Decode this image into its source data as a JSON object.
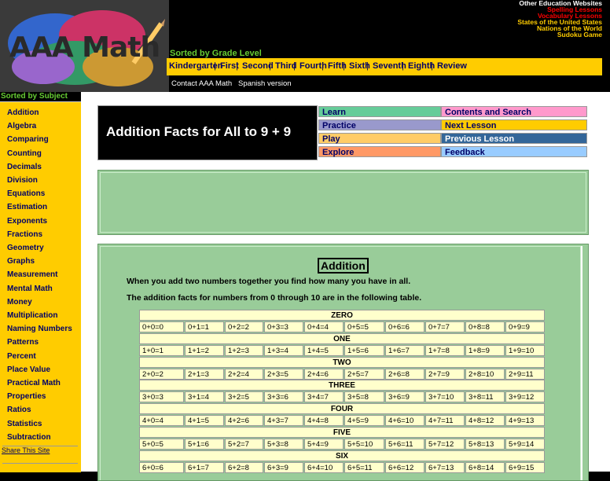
{
  "logo": {
    "text": "AAA Math"
  },
  "other_links": [
    {
      "label": "Other Education Websites",
      "color": "#ffffff"
    },
    {
      "label": "Spelling Lessons",
      "color": "#ff0000"
    },
    {
      "label": "Vocabulary Lessons",
      "color": "#ff0000"
    },
    {
      "label": "States of the United States",
      "color": "#ffcc00"
    },
    {
      "label": "Nations of the World",
      "color": "#ffcc00"
    },
    {
      "label": "Sudoku Game",
      "color": "#ffcc00"
    }
  ],
  "sorted_by_grade": "Sorted by Grade Level",
  "grades": [
    "Kindergarten",
    "First",
    "Second",
    "Third",
    "Fourth",
    "Fifth",
    "Sixth",
    "Seventh",
    "Eighth",
    "Review"
  ],
  "grade_separator": "|",
  "contact": "Contact AAA Math",
  "spanish": "Spanish version",
  "sorted_by_subject": "Sorted by Subject",
  "subjects": [
    "Addition",
    "Algebra",
    "Comparing",
    "Counting",
    "Decimals",
    "Division",
    "Equations",
    "Estimation",
    "Exponents",
    "Fractions",
    "Geometry",
    "Graphs",
    "Measurement",
    "Mental Math",
    "Money",
    "Multiplication",
    "Naming Numbers",
    "Patterns",
    "Percent",
    "Place Value",
    "Practical Math",
    "Properties",
    "Ratios",
    "Statistics",
    "Subtraction"
  ],
  "share": "Share This Site",
  "page_title": "Addition Facts for All to 9 + 9",
  "tabs": [
    {
      "label": "Learn",
      "bg": "#66cc99",
      "color": "#000066"
    },
    {
      "label": "Contents and Search",
      "bg": "#ff99cc",
      "color": "#000066"
    },
    {
      "label": "Practice",
      "bg": "#9999cc",
      "color": "#000066"
    },
    {
      "label": "Next Lesson",
      "bg": "#ffcc00",
      "color": "#000066"
    },
    {
      "label": "Play",
      "bg": "#ffcc66",
      "color": "#000066"
    },
    {
      "label": "Previous Lesson",
      "bg": "#336699",
      "color": "#ffffff"
    },
    {
      "label": "Explore",
      "bg": "#ff9966",
      "color": "#000066"
    },
    {
      "label": "Feedback",
      "bg": "#99ccff",
      "color": "#000066"
    }
  ],
  "section_title": "Addition",
  "paragraph1": "When you add two numbers together you find how many you have in all.",
  "paragraph2": "The addition facts for numbers from 0 through 10 are in the following table.",
  "fact_groups": [
    {
      "title": "ZERO",
      "facts": [
        "0+0=0",
        "0+1=1",
        "0+2=2",
        "0+3=3",
        "0+4=4",
        "0+5=5",
        "0+6=6",
        "0+7=7",
        "0+8=8",
        "0+9=9"
      ]
    },
    {
      "title": "ONE",
      "facts": [
        "1+0=1",
        "1+1=2",
        "1+2=3",
        "1+3=4",
        "1+4=5",
        "1+5=6",
        "1+6=7",
        "1+7=8",
        "1+8=9",
        "1+9=10"
      ]
    },
    {
      "title": "TWO",
      "facts": [
        "2+0=2",
        "2+1=3",
        "2+2=4",
        "2+3=5",
        "2+4=6",
        "2+5=7",
        "2+6=8",
        "2+7=9",
        "2+8=10",
        "2+9=11"
      ]
    },
    {
      "title": "THREE",
      "facts": [
        "3+0=3",
        "3+1=4",
        "3+2=5",
        "3+3=6",
        "3+4=7",
        "3+5=8",
        "3+6=9",
        "3+7=10",
        "3+8=11",
        "3+9=12"
      ]
    },
    {
      "title": "FOUR",
      "facts": [
        "4+0=4",
        "4+1=5",
        "4+2=6",
        "4+3=7",
        "4+4=8",
        "4+5=9",
        "4+6=10",
        "4+7=11",
        "4+8=12",
        "4+9=13"
      ]
    },
    {
      "title": "FIVE",
      "facts": [
        "5+0=5",
        "5+1=6",
        "5+2=7",
        "5+3=8",
        "5+4=9",
        "5+5=10",
        "5+6=11",
        "5+7=12",
        "5+8=13",
        "5+9=14"
      ]
    },
    {
      "title": "SIX",
      "facts": [
        "6+0=6",
        "6+1=7",
        "6+2=8",
        "6+3=9",
        "6+4=10",
        "6+5=11",
        "6+6=12",
        "6+7=13",
        "6+8=14",
        "6+9=15"
      ]
    }
  ]
}
